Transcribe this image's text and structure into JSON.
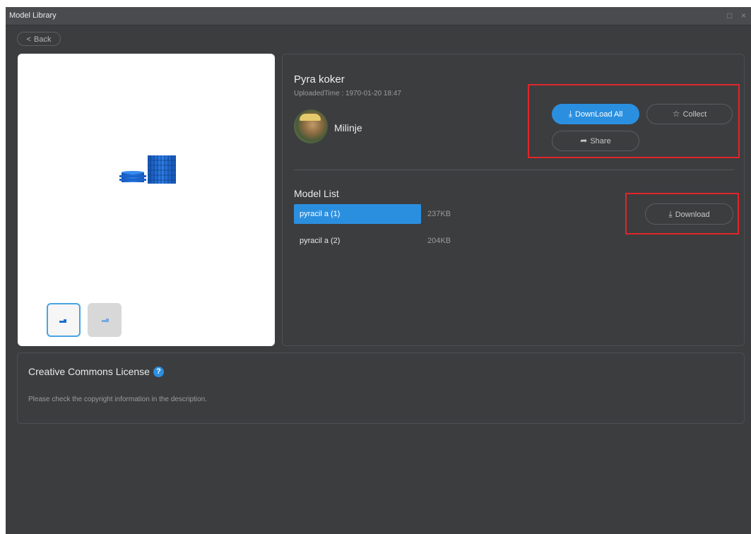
{
  "window": {
    "title": "Model Library",
    "maximize_glyph": "□",
    "close_glyph": "×"
  },
  "back": {
    "label": "Back",
    "chevron": "<"
  },
  "model": {
    "name": "Pyra koker",
    "uploaded": "UploadedTime : 1970-01-20 18:47",
    "author": "Milinje"
  },
  "actions": {
    "download_all": "DownLoad All",
    "collect": "Collect",
    "share": "Share",
    "download": "Download",
    "download_icon": "download-icon",
    "collect_icon": "star-icon",
    "share_icon": "share-icon"
  },
  "model_list": {
    "title": "Model List",
    "items": [
      {
        "name": "pyracil a (1)",
        "size": "237KB",
        "selected": true
      },
      {
        "name": "pyracil a (2)",
        "size": "204KB",
        "selected": false
      }
    ]
  },
  "license": {
    "title": "Creative Commons License",
    "help_glyph": "?",
    "description": "Please check the copyright information in the description."
  },
  "colors": {
    "accent": "#2b8fe0",
    "window_bg": "#3c3d3f",
    "highlight": "#e0262a",
    "model_blue": "#1d6fd4"
  }
}
